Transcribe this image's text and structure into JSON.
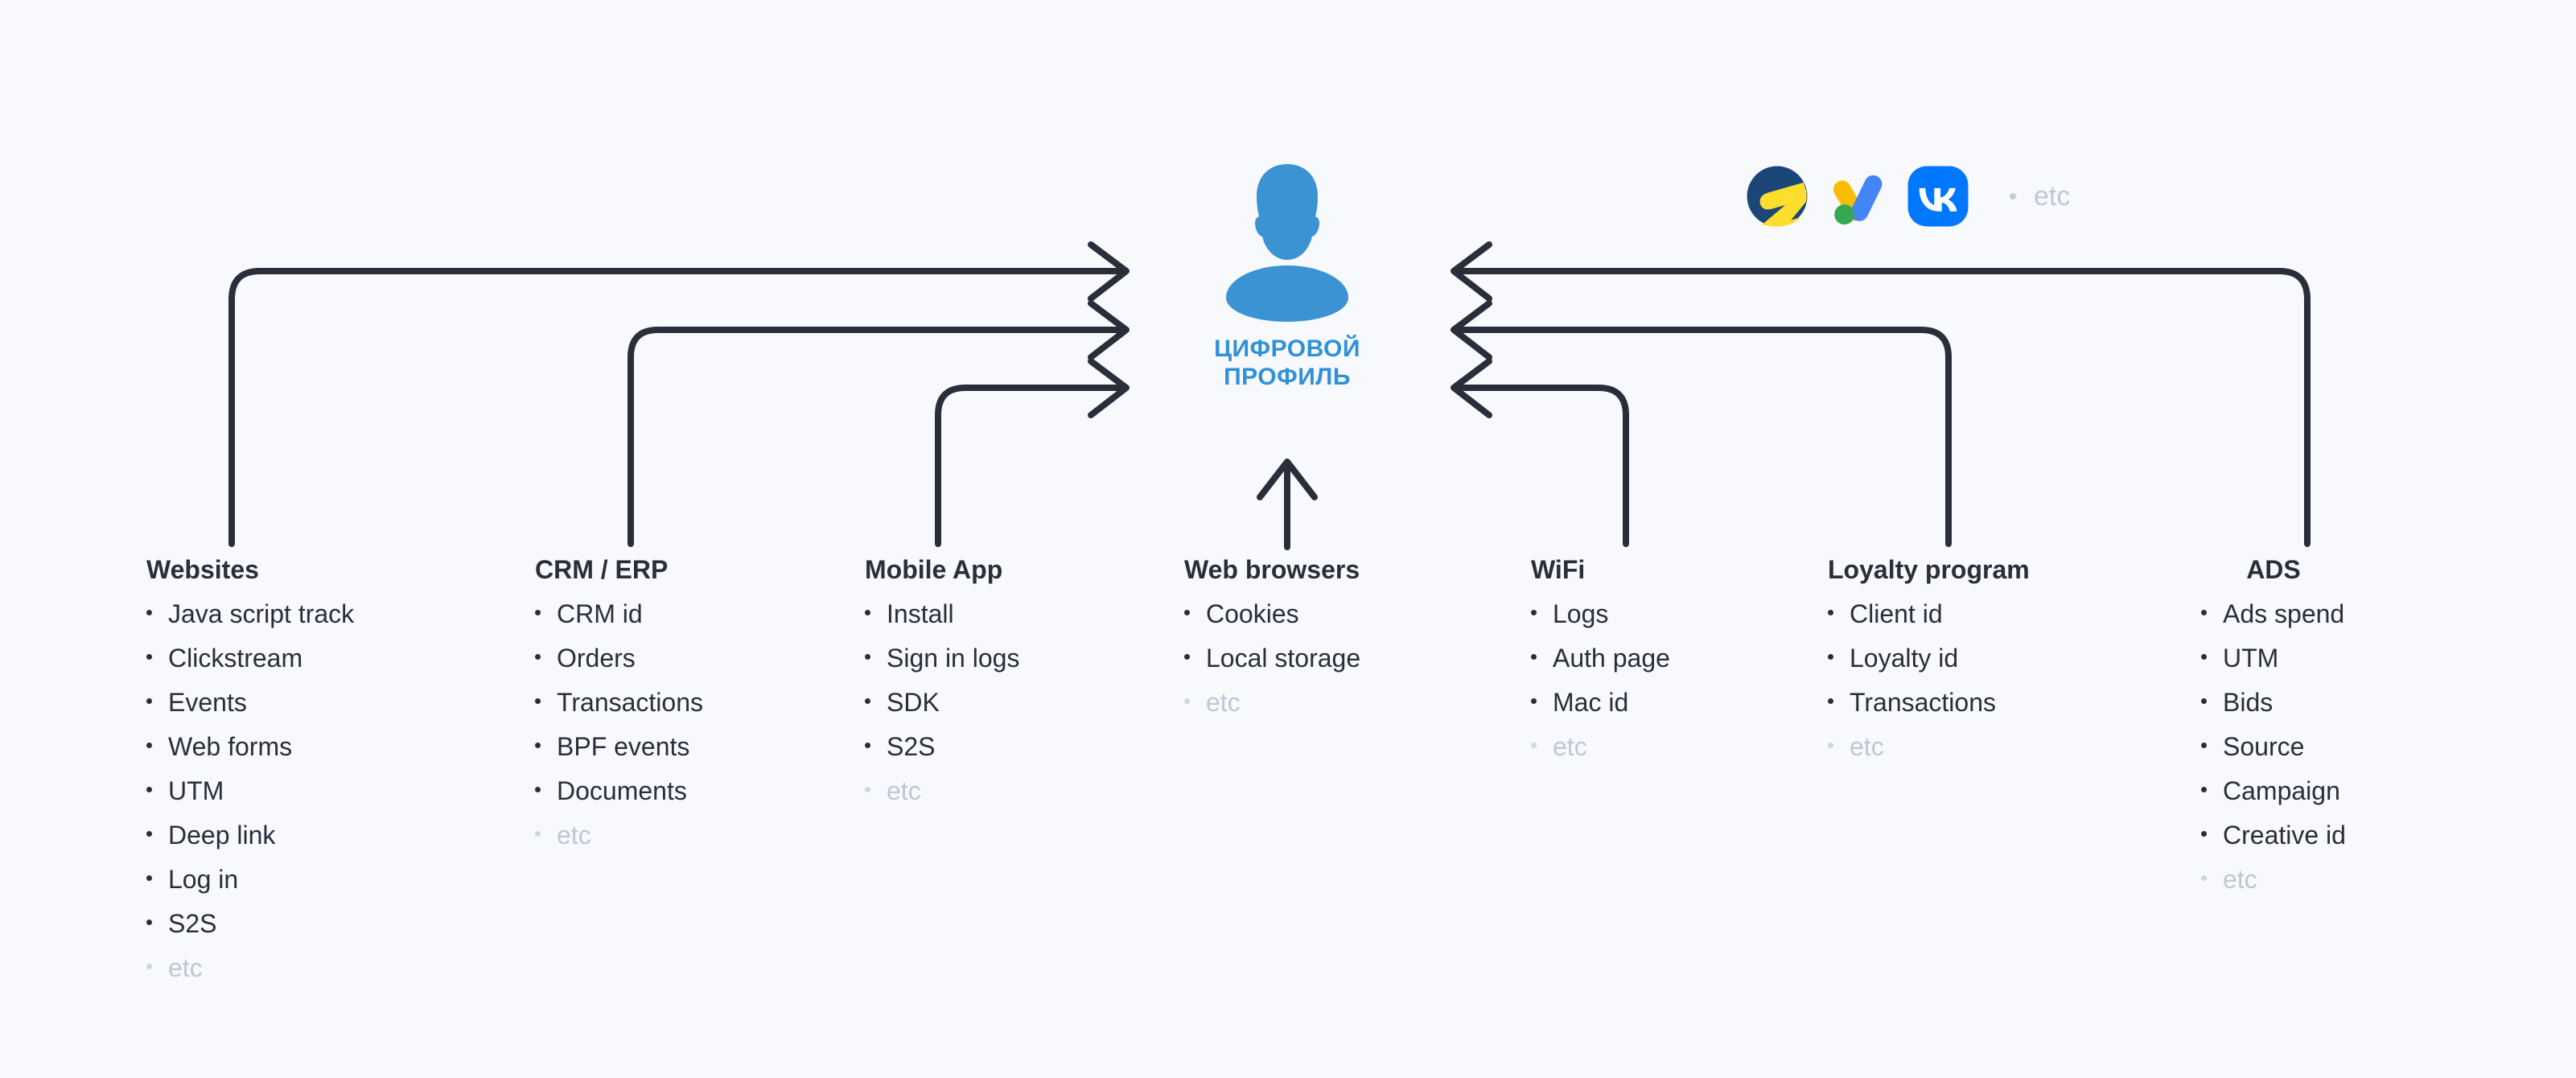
{
  "background_color": "#f7f9fc",
  "line_color": "#2b2d3a",
  "accent_color": "#2f91d8",
  "muted_color": "#bfc7d4",
  "center": {
    "avatar_icon": "person-silhouette-icon",
    "label_line1": "ЦИФРОВОЙ",
    "label_line2": "ПРОФИЛЬ"
  },
  "ad_platforms": {
    "logos": [
      {
        "name": "yandex-direct-logo",
        "label": "Yandex Direct"
      },
      {
        "name": "google-ads-logo",
        "label": "Google Ads"
      },
      {
        "name": "vk-logo",
        "label": "VK"
      }
    ],
    "etc_label": "etc"
  },
  "columns": [
    {
      "id": "websites",
      "title": "Websites",
      "items": [
        "Java script track",
        "Clickstream",
        "Events",
        "Web forms",
        "UTM",
        "Deep link",
        "Log in",
        "S2S"
      ],
      "etc_label": "etc"
    },
    {
      "id": "crm-erp",
      "title": "CRM / ERP",
      "items": [
        "CRM id",
        "Orders",
        "Transactions",
        "BPF events",
        "Documents"
      ],
      "etc_label": "etc"
    },
    {
      "id": "mobile-app",
      "title": "Mobile App",
      "items": [
        "Install",
        "Sign in logs",
        "SDK",
        "S2S"
      ],
      "etc_label": "etc"
    },
    {
      "id": "web-browsers",
      "title": "Web browsers",
      "items": [
        "Cookies",
        "Local storage"
      ],
      "etc_label": "etc"
    },
    {
      "id": "wifi",
      "title": "WiFi",
      "items": [
        "Logs",
        "Auth page",
        "Mac id"
      ],
      "etc_label": "etc"
    },
    {
      "id": "loyalty-program",
      "title": "Loyalty program",
      "items": [
        "Client id",
        "Loyalty id",
        "Transactions"
      ],
      "etc_label": "etc"
    },
    {
      "id": "ads",
      "title": "ADS",
      "items": [
        "Ads spend",
        "UTM",
        "Bids",
        "Source",
        "Campaign",
        "Creative id"
      ],
      "etc_label": "etc"
    }
  ]
}
